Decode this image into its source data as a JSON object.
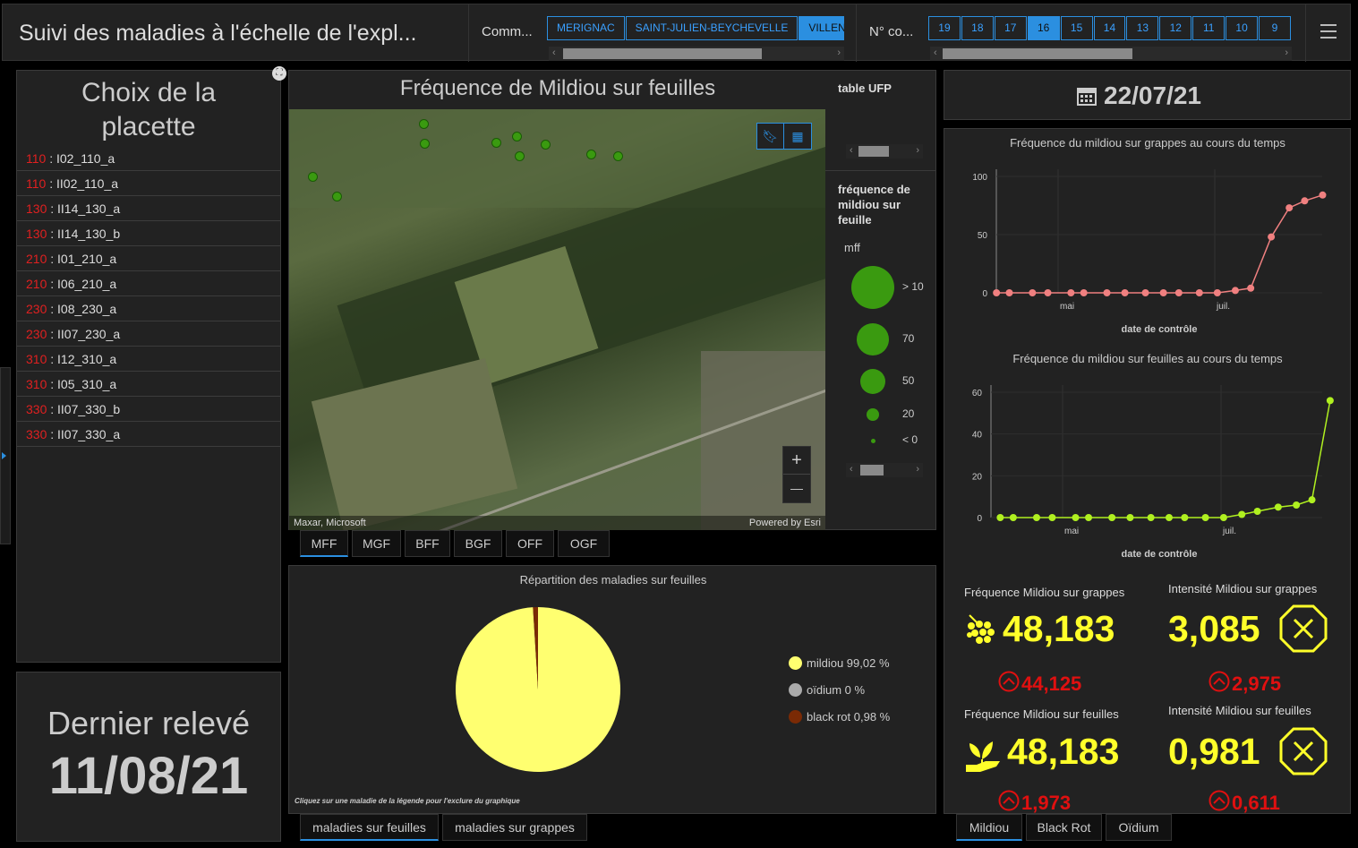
{
  "header": {
    "title": "Suivi des maladies à l'échelle de l'expl...",
    "commune_label": "Comm...",
    "communes": [
      "MERIGNAC",
      "SAINT-JULIEN-BEYCHEVELLE",
      "VILLENA"
    ],
    "commune_selected": "VILLENA",
    "controle_label": "N° co...",
    "controles": [
      "19",
      "18",
      "17",
      "16",
      "15",
      "14",
      "13",
      "12",
      "11",
      "10",
      "9"
    ],
    "controle_selected": "16",
    "menu_icon": "hamburger-icon"
  },
  "placette": {
    "title_line1": "Choix de la",
    "title_line2": "placette",
    "items": [
      {
        "code": "110",
        "name": "I02_110_a"
      },
      {
        "code": "110",
        "name": "II02_110_a"
      },
      {
        "code": "130",
        "name": "II14_130_a"
      },
      {
        "code": "130",
        "name": "II14_130_b"
      },
      {
        "code": "210",
        "name": "I01_210_a"
      },
      {
        "code": "210",
        "name": "I06_210_a"
      },
      {
        "code": "230",
        "name": "I08_230_a"
      },
      {
        "code": "230",
        "name": "II07_230_a"
      },
      {
        "code": "310",
        "name": "I12_310_a"
      },
      {
        "code": "310",
        "name": "I05_310_a"
      },
      {
        "code": "330",
        "name": "II07_330_b"
      },
      {
        "code": "330",
        "name": "II07_330_a"
      }
    ]
  },
  "dernier": {
    "label": "Dernier relevé",
    "date": "11/08/21"
  },
  "map": {
    "title": "Fréquence de Mildiou sur feuilles",
    "attribution_left": "Maxar, Microsoft",
    "attribution_right": "Powered by Esri",
    "zoom_in": "+",
    "zoom_out": "—",
    "legend": {
      "table_title": "table UFP",
      "layer_title": "fréquence de mildiou sur feuille",
      "field": "mff",
      "classes": [
        "> 10",
        "70",
        "50",
        "20",
        "< 0"
      ],
      "color": "#3a9a10"
    },
    "tabs": [
      "MFF",
      "MGF",
      "BFF",
      "BGF",
      "OFF",
      "OGF"
    ],
    "tab_selected": "MFF"
  },
  "pie": {
    "title": "Répartition des maladies sur feuilles",
    "note": "Cliquez sur une maladie de la légende pour l'exclure du graphique",
    "tabs": [
      "maladies sur feuilles",
      "maladies sur grappes"
    ],
    "tab_selected": "maladies sur feuilles"
  },
  "date_panel": {
    "date": "22/07/21",
    "icon": "calendar-icon"
  },
  "chart_data": [
    {
      "type": "pie",
      "title": "Répartition des maladies sur feuilles",
      "slices": [
        {
          "name": "mildiou",
          "value": 99.02,
          "label": "mildiou  99,02 %",
          "color": "#ffff70"
        },
        {
          "name": "oïdium",
          "value": 0,
          "label": "oïdium  0 %",
          "color": "#aaaaaa"
        },
        {
          "name": "black rot",
          "value": 0.98,
          "label": "black rot  0,98 %",
          "color": "#7a2a05"
        }
      ]
    },
    {
      "type": "line",
      "title": "Fréquence du mildiou sur grappes au cours du temps",
      "xlabel": "date de contrôle",
      "xticks": [
        "mai",
        "juil."
      ],
      "yticks": [
        "0",
        "50",
        "100"
      ],
      "ylim": [
        0,
        100
      ],
      "color": "#f08080",
      "x": [
        "2021-04-07",
        "2021-04-12",
        "2021-04-21",
        "2021-04-27",
        "2021-05-06",
        "2021-05-11",
        "2021-05-20",
        "2021-05-27",
        "2021-06-04",
        "2021-06-11",
        "2021-06-17",
        "2021-06-25",
        "2021-07-02",
        "2021-07-09",
        "2021-07-15",
        "2021-07-23",
        "2021-07-30",
        "2021-08-05",
        "2021-08-12"
      ],
      "values": [
        0,
        0,
        0,
        0,
        0,
        0,
        0,
        0,
        0,
        0,
        0,
        0,
        0,
        2,
        4,
        48,
        73,
        79,
        84
      ]
    },
    {
      "type": "line",
      "title": "Fréquence du mildiou sur feuilles au cours du temps",
      "xlabel": "date de contrôle",
      "xticks": [
        "mai",
        "juil."
      ],
      "yticks": [
        "0",
        "20",
        "40",
        "60"
      ],
      "ylim": [
        0,
        60
      ],
      "color": "#b0f020",
      "x": [
        "2021-04-07",
        "2021-04-12",
        "2021-04-21",
        "2021-04-27",
        "2021-05-06",
        "2021-05-11",
        "2021-05-20",
        "2021-05-27",
        "2021-06-04",
        "2021-06-11",
        "2021-06-17",
        "2021-06-25",
        "2021-07-02",
        "2021-07-09",
        "2021-07-15",
        "2021-07-23",
        "2021-07-30",
        "2021-08-05",
        "2021-08-12"
      ],
      "values": [
        0,
        0,
        0,
        0,
        0,
        0,
        0,
        0,
        0,
        0,
        0,
        0,
        0,
        1.5,
        3,
        5,
        6,
        8.5,
        56
      ]
    }
  ],
  "kpis": [
    {
      "title": "Fréquence Mildiou sur grappes",
      "value": "48,183",
      "delta": "44,125",
      "icon": "grapes-icon"
    },
    {
      "title": "Intensité Mildiou sur grappes",
      "value": "3,085",
      "delta": "2,975",
      "icon": "octagon-x-icon"
    },
    {
      "title": "Fréquence Mildiou sur feuilles",
      "value": "48,183",
      "delta": "1,973",
      "icon": "plant-hand-icon"
    },
    {
      "title": "Intensité Mildiou sur feuilles",
      "value": "0,981",
      "delta": "0,611",
      "icon": "octagon-x-icon"
    }
  ],
  "disease_tabs": [
    "Mildiou",
    "Black Rot",
    "Oïdium"
  ],
  "disease_selected": "Mildiou",
  "colors": {
    "accent": "#2b8fe0",
    "kpi": "#ffff2a",
    "delta": "#e01010",
    "code": "#e02020"
  }
}
